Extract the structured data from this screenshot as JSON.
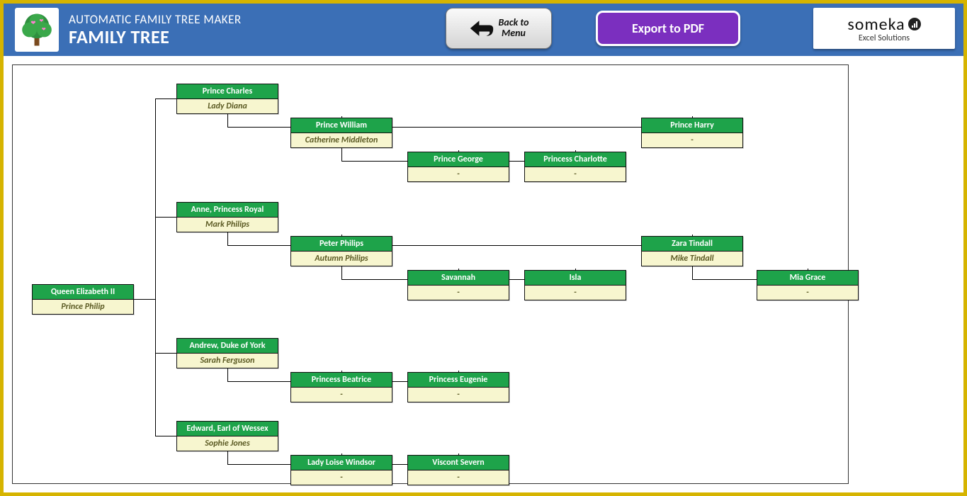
{
  "header": {
    "subtitle": "AUTOMATIC FAMILY TREE MAKER",
    "title": "FAMILY TREE",
    "back_label_line1": "Back to",
    "back_label_line2": "Menu",
    "export_label": "Export to PDF",
    "brand_name": "someka",
    "brand_sub": "Excel Solutions"
  },
  "nodes": {
    "root": {
      "primary": "Queen Elizabeth II",
      "secondary": "Prince Philip"
    },
    "charles": {
      "primary": "Prince Charles",
      "secondary": "Lady Diana"
    },
    "william": {
      "primary": "Prince William",
      "secondary": "Catherine Middleton"
    },
    "george": {
      "primary": "Prince George",
      "secondary": "-"
    },
    "charlotte": {
      "primary": "Princess Charlotte",
      "secondary": "-"
    },
    "harry": {
      "primary": "Prince Harry",
      "secondary": "-"
    },
    "anne": {
      "primary": "Anne, Princess Royal",
      "secondary": "Mark Philips"
    },
    "peter": {
      "primary": "Peter Philips",
      "secondary": "Autumn Philips"
    },
    "savannah": {
      "primary": "Savannah",
      "secondary": "-"
    },
    "isla": {
      "primary": "Isla",
      "secondary": "-"
    },
    "zara": {
      "primary": "Zara Tindall",
      "secondary": "Mike Tindall"
    },
    "mia": {
      "primary": "Mia Grace",
      "secondary": "-"
    },
    "andrew": {
      "primary": "Andrew, Duke of York",
      "secondary": "Sarah Ferguson"
    },
    "beatrice": {
      "primary": "Princess Beatrice",
      "secondary": "-"
    },
    "eugenie": {
      "primary": "Princess Eugenie",
      "secondary": "-"
    },
    "edward": {
      "primary": "Edward, Earl of Wessex",
      "secondary": "Sophie Jones"
    },
    "loise": {
      "primary": "Lady Loise Windsor",
      "secondary": "-"
    },
    "viscont": {
      "primary": "Viscont Severn",
      "secondary": "-"
    }
  }
}
